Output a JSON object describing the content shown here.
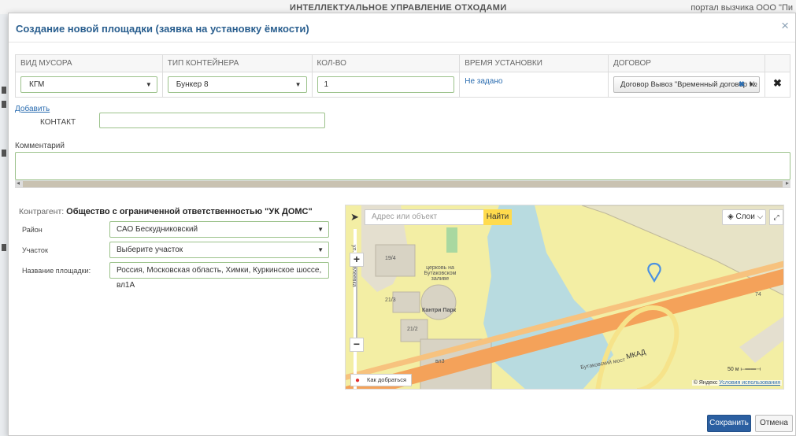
{
  "background_header": {
    "center_title": "ИНТЕЛЛЕКТУАЛЬНОЕ УПРАВЛЕНИЕ ОТХОДАМИ",
    "right_text": "портал вызчика ООО \"Пи"
  },
  "modal": {
    "title": "Создание новой площадки (заявка на установку ёмкости)",
    "close_icon": "×"
  },
  "table": {
    "headers": {
      "waste_type": "ВИД МУСОРА",
      "container_type": "ТИП КОНТЕЙНЕРА",
      "quantity": "КОЛ-ВО",
      "install_time": "ВРЕМЯ УСТАНОВКИ",
      "contract": "ДОГОВОР"
    },
    "row": {
      "waste_type": "КГМ",
      "container_type": "Бункер 8",
      "quantity": "1",
      "install_time": "Не задано",
      "contract": "Договор Вывоз \"Временный договор №",
      "remove_icon": "✖"
    }
  },
  "add_link": "Добавить",
  "contact": {
    "label": "КОНТАКТ",
    "value": ""
  },
  "comment": {
    "label": "Комментарий",
    "value": ""
  },
  "kontragent": {
    "label": "Контрагент:",
    "name": "Общество с ограниченной ответственностью \"УК ДОМС\""
  },
  "fields": {
    "district": {
      "label": "Район",
      "value": "САО Бескудниковский"
    },
    "plot": {
      "label": "Участок",
      "value": "Выберите участок"
    },
    "site_name": {
      "label": "Название площадки:",
      "value": "Россия, Московская область, Химки, Куркинское шоссе, вл1А"
    }
  },
  "map": {
    "search_placeholder": "Адрес или объект",
    "find_button": "Найти",
    "layers_button": "Слои",
    "route_button": "Как добраться",
    "scale": "50 м",
    "copyright_prefix": "© Яндекс",
    "copyright_link": "Условия использования",
    "labels": {
      "street": "ул. Пантелеевка",
      "church": "церковь на Бутаковском заливе",
      "mall": "Кантри Парк",
      "b1": "19/4",
      "b2": "21/3",
      "b3": "21/2",
      "b4": "вл3",
      "road1": "Бутаковский мост",
      "road2": "МКАД",
      "num": "74"
    }
  },
  "buttons": {
    "save": "Сохранить",
    "cancel": "Отмена"
  },
  "colors": {
    "primary": "#2b5fa1",
    "field_border": "#9cc28b",
    "title": "#2a5f8f",
    "map_find": "#ffdb4d"
  }
}
